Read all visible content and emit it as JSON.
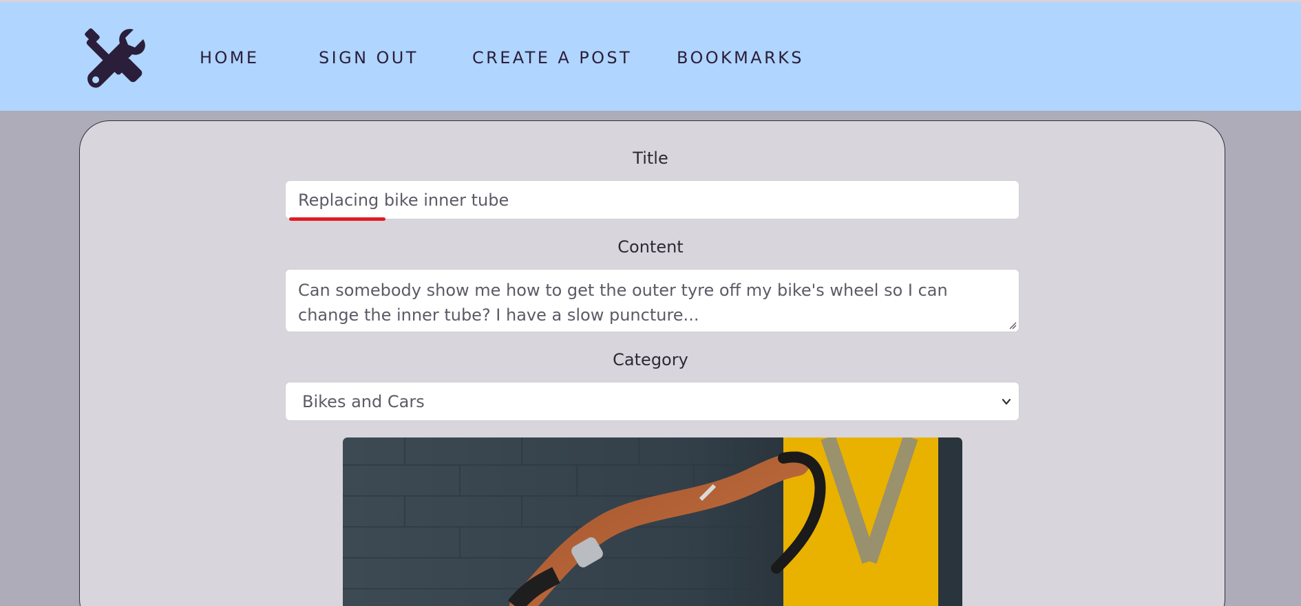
{
  "nav": {
    "logo_icon": "tools-icon",
    "links": [
      "HOME",
      "SIGN OUT",
      "CREATE A POST",
      "BOOKMARKS"
    ]
  },
  "form": {
    "title_label": "Title",
    "title_value": "Replacing bike inner tube",
    "content_label": "Content",
    "content_value": "Can somebody show me how to get the outer tyre off my bike's wheel so I can change the inner tube? I have a slow puncture...",
    "category_label": "Category",
    "category_selected": "Bikes and Cars"
  },
  "colors": {
    "nav_bg": "#b0d5fe",
    "page_bg": "#aeacb8",
    "card_bg": "#d8d6dc",
    "logo": "#2a1e3a",
    "spellcheck": "#e01b24"
  }
}
